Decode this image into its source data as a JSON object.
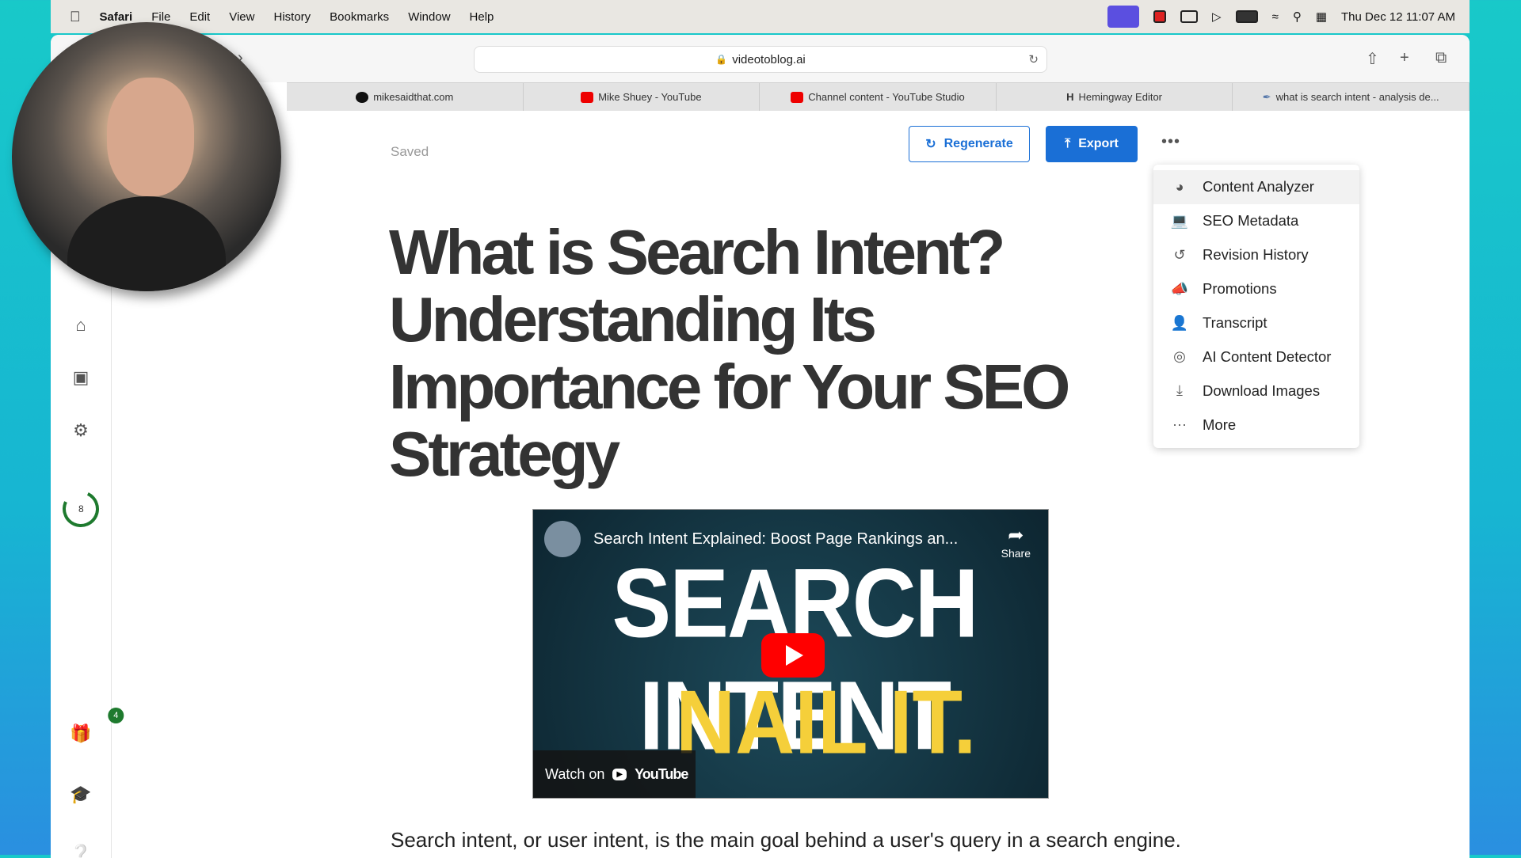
{
  "menubar": {
    "app": "Safari",
    "items": [
      "File",
      "Edit",
      "View",
      "History",
      "Bookmarks",
      "Window",
      "Help"
    ],
    "clock": "Thu Dec 12  11:07 AM"
  },
  "browser": {
    "url": "videotoblog.ai",
    "tabs": [
      {
        "label": "mikesaidthat.com",
        "icon": "circle-logo"
      },
      {
        "label": "Mike Shuey - YouTube",
        "icon": "youtube"
      },
      {
        "label": "Channel content - YouTube Studio",
        "icon": "youtube"
      },
      {
        "label": "Hemingway Editor",
        "icon": "hemingway-h"
      },
      {
        "label": "what is search intent - analysis de...",
        "icon": "feather"
      }
    ]
  },
  "sidebar": {
    "credits": "8",
    "gift_badge": "4"
  },
  "editor": {
    "status": "Saved",
    "regenerate_label": "Regenerate",
    "export_label": "Export",
    "accent": "#1a6fd6"
  },
  "menu": {
    "items": [
      {
        "label": "Content Analyzer",
        "icon": "gauge-icon"
      },
      {
        "label": "SEO Metadata",
        "icon": "laptop-search-icon"
      },
      {
        "label": "Revision History",
        "icon": "history-icon"
      },
      {
        "label": "Promotions",
        "icon": "megaphone-icon"
      },
      {
        "label": "Transcript",
        "icon": "speaker-person-icon"
      },
      {
        "label": "AI Content Detector",
        "icon": "target-icon"
      },
      {
        "label": "Download Images",
        "icon": "download-icon"
      },
      {
        "label": "More",
        "icon": "ellipsis-icon"
      }
    ]
  },
  "article": {
    "title": "What is Search Intent? Understanding Its Importance for Your SEO Strategy",
    "video": {
      "title": "Search Intent Explained: Boost Page Rankings an...",
      "share": "Share",
      "thumb_line1": "SEARCH INTENT",
      "thumb_line2": "NAIL IT.",
      "watch_on": "Watch on",
      "youtube": "YouTube"
    },
    "intro": "Search intent, or user intent, is the main goal behind a user's query in a search engine."
  }
}
